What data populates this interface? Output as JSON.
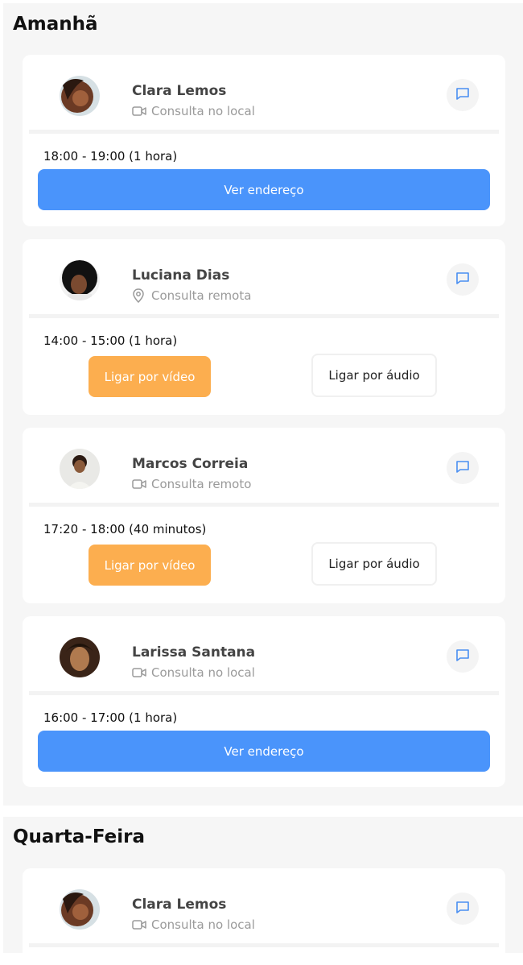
{
  "sections": [
    {
      "title": "Amanhã",
      "cards": [
        {
          "name": "Clara Lemos",
          "subtitle": "Consulta no local",
          "subtitle_icon": "video-icon",
          "time": "18:00 - 19:00 (1 hora)",
          "primary_label": "Ver endereço"
        },
        {
          "name": "Luciana Dias",
          "subtitle": "Consulta remota",
          "subtitle_icon": "location-pin-icon",
          "time": "14:00 - 15:00 (1 hora)",
          "video_label": "Ligar por vídeo",
          "audio_label": "Ligar por áudio"
        },
        {
          "name": "Marcos Correia",
          "subtitle": "Consulta remoto",
          "subtitle_icon": "video-icon",
          "time": "17:20 - 18:00 (40 minutos)",
          "video_label": "Ligar por vídeo",
          "audio_label": "Ligar por áudio"
        },
        {
          "name": "Larissa Santana",
          "subtitle": "Consulta no local",
          "subtitle_icon": "video-icon",
          "time": "16:00 - 17:00 (1 hora)",
          "primary_label": "Ver endereço"
        }
      ]
    },
    {
      "title": "Quarta-Feira",
      "cards": [
        {
          "name": "Clara Lemos",
          "subtitle": "Consulta no local",
          "subtitle_icon": "video-icon"
        }
      ]
    }
  ],
  "colors": {
    "primary_button": "#4a94fb",
    "video_button": "#fcae4f",
    "chat_icon": "#4a8ff2",
    "section_bg": "#f6f6f6"
  }
}
